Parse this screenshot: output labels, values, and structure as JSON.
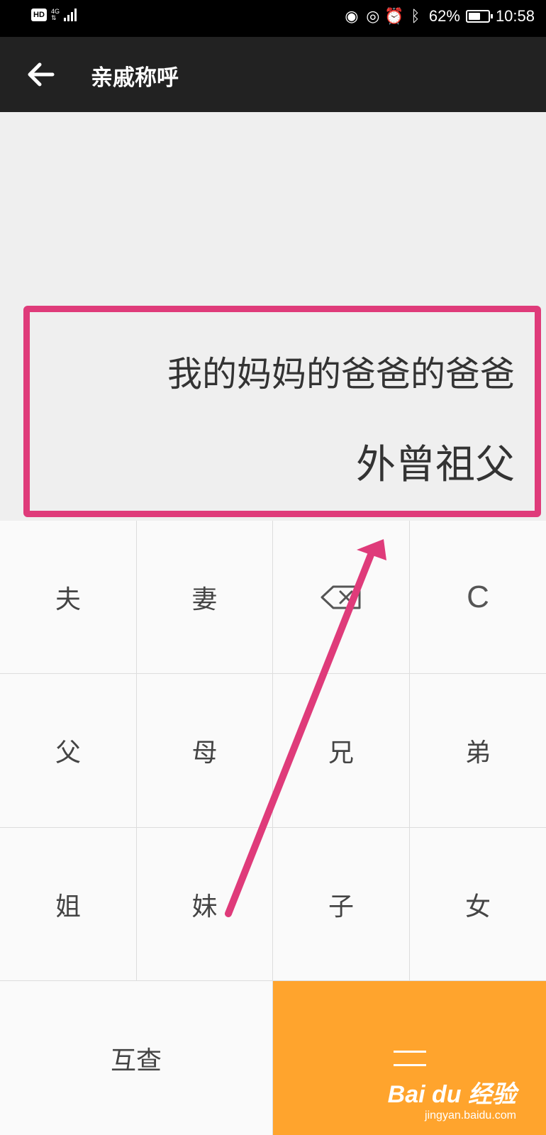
{
  "status_bar": {
    "hd": "HD",
    "network": "4G",
    "battery_text": "62%",
    "battery_level": 0.62,
    "time": "10:58"
  },
  "app_bar": {
    "title": "亲戚称呼",
    "back_icon": "arrow-left-icon"
  },
  "display": {
    "expression": "我的妈妈的爸爸的爸爸",
    "result": "外曾祖父",
    "highlight_color": "#df3b7a"
  },
  "keypad": {
    "row1": [
      "夫",
      "妻",
      "backspace",
      "C"
    ],
    "row2": [
      "父",
      "母",
      "兄",
      "弟"
    ],
    "row3": [
      "姐",
      "妹",
      "子",
      "女"
    ],
    "mutual_check": "互查",
    "equals_icon": "equals-icon",
    "accent_color": "#ffa42d"
  },
  "watermark": {
    "logo": "Bai du 经验",
    "url": "jingyan.baidu.com"
  }
}
